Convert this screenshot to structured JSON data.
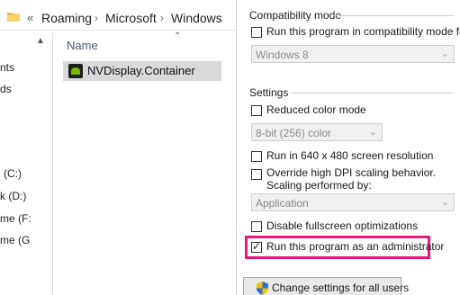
{
  "explorer": {
    "breadcrumb": [
      "Roaming",
      "Microsoft",
      "Windows"
    ],
    "overflow_glyph": "«",
    "separator_glyph": "›",
    "nav_items": [
      "nts",
      "ds",
      "(C:)",
      "k (D:)",
      "me (F:",
      "me (G"
    ],
    "column_header": "Name",
    "file_name": "NVDisplay.Container"
  },
  "dialog": {
    "compat_group": "Compatibility mode",
    "compat_checkbox": "Run this program in compatibility mode for:",
    "compat_dropdown": "Windows 8",
    "settings_group": "Settings",
    "reduced_color": "Reduced color mode",
    "color_dropdown": "8-bit (256) color",
    "res_640": "Run in 640 x 480 screen resolution",
    "dpi_line1": "Override high DPI scaling behavior.",
    "dpi_line2": "Scaling performed by:",
    "dpi_dropdown": "Application",
    "fullscreen": "Disable fullscreen optimizations",
    "admin": "Run this program as an administrator",
    "admin_checked": true,
    "change_all_button": "Change settings for all users"
  },
  "colors": {
    "highlight": "#e8177b",
    "nvidia_green": "#76b900"
  }
}
